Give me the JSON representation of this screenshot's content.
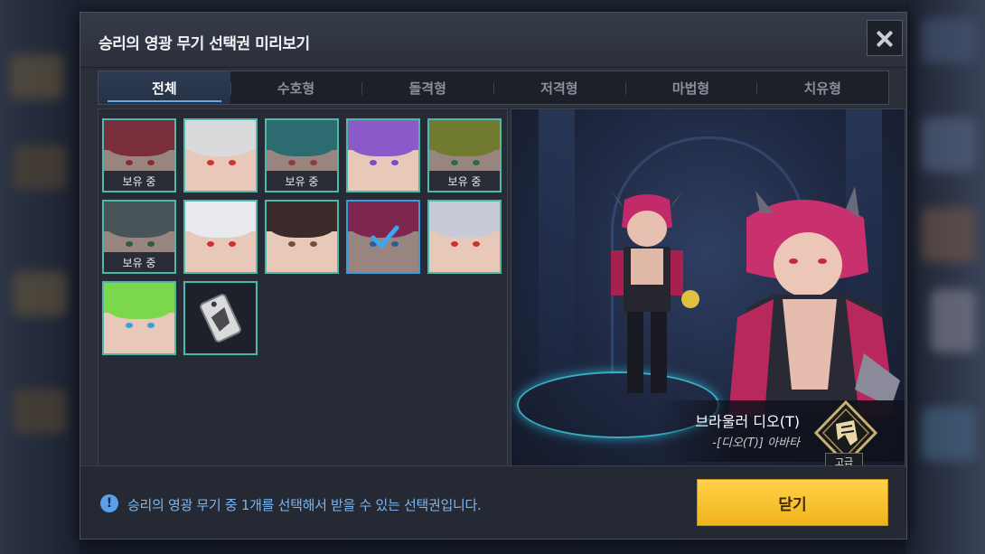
{
  "dialog": {
    "title": "승리의 영광 무기 선택권 미리보기"
  },
  "tabs": [
    {
      "label": "전체",
      "active": true
    },
    {
      "label": "수호형",
      "active": false
    },
    {
      "label": "돌격형",
      "active": false
    },
    {
      "label": "저격형",
      "active": false
    },
    {
      "label": "마법형",
      "active": false
    },
    {
      "label": "치유형",
      "active": false
    }
  ],
  "grid": {
    "owned_label": "보유 중",
    "items": [
      {
        "owned": true,
        "selected": false,
        "hair": "#b83a4a",
        "eye": "#d83232"
      },
      {
        "owned": false,
        "selected": false,
        "hair": "#d8dadc",
        "eye": "#d03030"
      },
      {
        "owned": true,
        "selected": false,
        "hair": "#3aa0a0",
        "eye": "#e05050"
      },
      {
        "owned": false,
        "selected": false,
        "hair": "#8a5ac8",
        "eye": "#7a4ad0"
      },
      {
        "owned": true,
        "selected": false,
        "hair": "#a8b83a",
        "eye": "#3aa050"
      },
      {
        "owned": true,
        "selected": false,
        "hair": "#6a7a7a",
        "eye": "#3a8a5a"
      },
      {
        "owned": false,
        "selected": false,
        "hair": "#e8eaee",
        "eye": "#d03030"
      },
      {
        "owned": false,
        "selected": false,
        "hair": "#3a2a2a",
        "eye": "#7a4a3a"
      },
      {
        "owned": false,
        "selected": true,
        "hair": "#c0306a",
        "eye": "#3a8ad8"
      },
      {
        "owned": false,
        "selected": false,
        "hair": "#c8cad8",
        "eye": "#d03030"
      },
      {
        "owned": false,
        "selected": false,
        "hair": "#7ad84a",
        "eye": "#3aa0d8"
      },
      {
        "owned": false,
        "selected": false,
        "hair": "item",
        "eye": ""
      }
    ]
  },
  "preview": {
    "character_name": "브라울러 디오(T)",
    "avatar_subtitle": "-[디오(T)] 아바타",
    "grade": "고급"
  },
  "footer": {
    "info_icon": "!",
    "info_text": "승리의 영광 무기 중 1개를 선택해서 받을 수 있는 선택권입니다.",
    "close_label": "닫기"
  }
}
